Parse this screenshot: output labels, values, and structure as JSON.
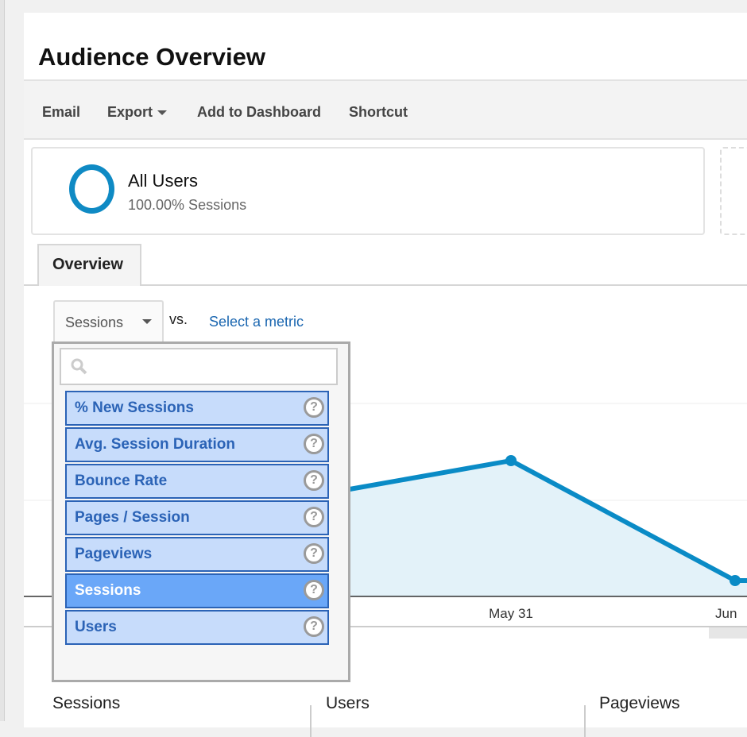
{
  "header": {
    "title": "Audience Overview"
  },
  "toolbar": {
    "email": "Email",
    "export": "Export",
    "add_to_dashboard": "Add to Dashboard",
    "shortcut": "Shortcut"
  },
  "segment": {
    "name": "All Users",
    "subtitle": "100.00% Sessions",
    "color": "#0f8ac4"
  },
  "tabs": [
    {
      "label": "Overview",
      "active": true
    }
  ],
  "metric_picker": {
    "selected": "Sessions",
    "vs_label": "vs.",
    "select_metric": "Select a metric",
    "search_placeholder": "",
    "options": [
      {
        "label": "% New Sessions"
      },
      {
        "label": "Avg. Session Duration"
      },
      {
        "label": "Bounce Rate"
      },
      {
        "label": "Pages / Session"
      },
      {
        "label": "Pageviews"
      },
      {
        "label": "Sessions",
        "selected": true
      },
      {
        "label": "Users"
      }
    ]
  },
  "chart": {
    "x_labels": [
      "May 31",
      "Jun"
    ],
    "line_color": "#0a8bc6",
    "fill_color": "#e3f2f9"
  },
  "bottom_metrics": [
    "Sessions",
    "Users",
    "Pageviews"
  ]
}
